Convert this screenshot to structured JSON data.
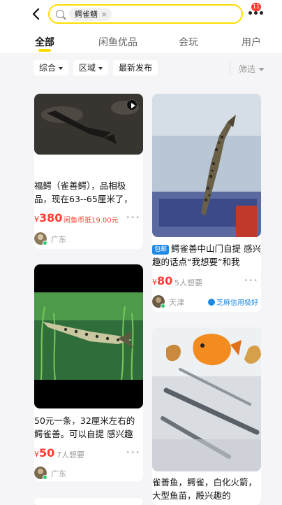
{
  "header": {
    "search_tag": "鳄雀鳝",
    "search_clear": "×",
    "notification_count": "11"
  },
  "tabs": [
    {
      "label": "全部",
      "active": true
    },
    {
      "label": "闲鱼优品",
      "active": false
    },
    {
      "label": "会玩",
      "active": false
    },
    {
      "label": "用户",
      "active": false
    }
  ],
  "filters": {
    "sort": "综合",
    "region": "区域",
    "latest": "最新发布",
    "screen": "筛选"
  },
  "products": [
    {
      "title": "福鳄（雀善鳄），品相极品，现在63--65厘米了，",
      "price": "380",
      "currency": "¥",
      "extra": "闲鱼币抵19.00元",
      "location": "广东",
      "has_video": true
    },
    {
      "title": "鳄雀善中山门自提 感兴趣的话点“我想要”和我",
      "tag": "包邮",
      "price": "80",
      "currency": "¥",
      "want": "5人想要",
      "location": "天津",
      "credit": "芝麻信用极好"
    },
    {
      "title": "50元一条，32厘米左右的鳄雀善。可以自提 感兴趣",
      "price": "50",
      "currency": "¥",
      "want": "7人想要",
      "location": "广东"
    },
    {
      "title": "雀善鱼，鳄雀，白化火箭，大型鱼苗，殿兴趣的"
    }
  ],
  "colors": {
    "accent": "#ffdd00",
    "price": "#ff3b30",
    "online": "#2ecc71",
    "credit": "#1e88e5"
  }
}
